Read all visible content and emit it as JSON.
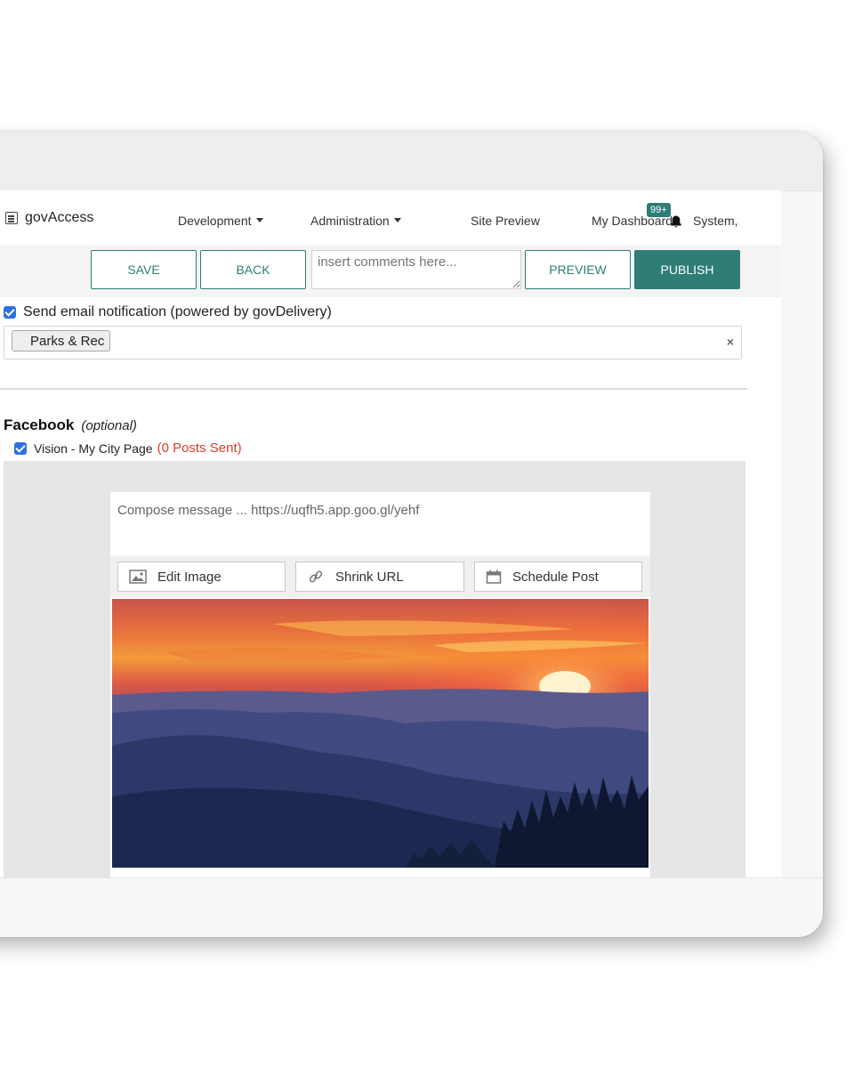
{
  "nav": {
    "brand": "govAccess",
    "development": "Development",
    "administration": "Administration",
    "site_preview": "Site Preview",
    "my_dashboard": "My Dashboard",
    "notification_count": "99+",
    "user": "System,"
  },
  "toolbar": {
    "save": "SAVE",
    "back": "BACK",
    "comments_placeholder": "insert comments here...",
    "preview": "PREVIEW",
    "publish": "PUBLISH"
  },
  "email": {
    "checked": true,
    "label": "Send email notification (powered by govDelivery)",
    "tags": [
      "Parks & Rec"
    ],
    "clear": "×"
  },
  "facebook": {
    "heading": "Facebook",
    "optional": "(optional)",
    "page_checked": true,
    "page_name": "Vision - My City Page",
    "posts_sent": "(0 Posts Sent)",
    "compose_placeholder": "Compose message ... https://uqfh5.app.goo.gl/yehf",
    "edit_image": "Edit Image",
    "shrink_url": "Shrink URL",
    "schedule_post": "Schedule Post"
  },
  "colors": {
    "accent": "#2e7d77",
    "checkbox": "#2f6fe0",
    "alert": "#e03b2a"
  }
}
